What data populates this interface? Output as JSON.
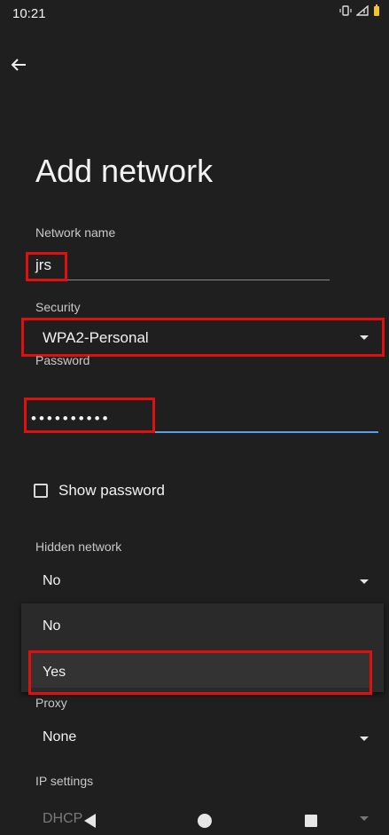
{
  "status_bar": {
    "time": "10:21",
    "icons": [
      "vibrate-icon",
      "signal-icon",
      "battery-icon"
    ]
  },
  "header": {
    "back_icon": "arrow-left-icon",
    "title": "Add network"
  },
  "fields": {
    "network_name": {
      "label": "Network name",
      "value": "jrs"
    },
    "security": {
      "label": "Security",
      "value": "WPA2-Personal"
    },
    "password": {
      "label": "Password",
      "value": "••••••••••"
    }
  },
  "show_password": {
    "label": "Show password",
    "checked": false
  },
  "hidden_network": {
    "label": "Hidden network",
    "value": "No",
    "options": [
      "No",
      "Yes"
    ]
  },
  "proxy": {
    "label": "Proxy",
    "value": "None"
  },
  "ip_settings": {
    "label": "IP settings",
    "value": "DHCP"
  },
  "nav": [
    "back-icon",
    "home-icon",
    "recents-icon"
  ],
  "colors": {
    "background": "#1f1f1f",
    "highlight": "#e01010",
    "accent": "#5aa0e8"
  }
}
